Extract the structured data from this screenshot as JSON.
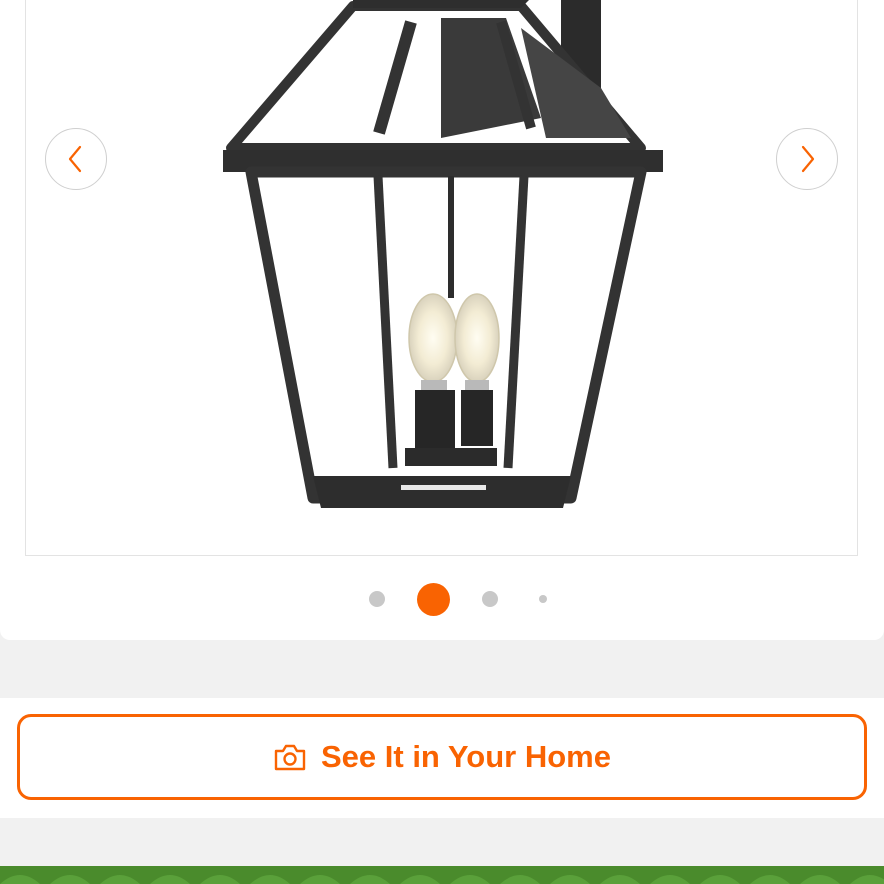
{
  "carousel": {
    "product_image_alt": "Black outdoor wall lantern with clear glass panels and candelabra bulbs",
    "prev_icon": "chevron-left-icon",
    "next_icon": "chevron-right-icon",
    "slide_count": 4,
    "active_slide": 2
  },
  "cta": {
    "label": "See It in Your Home",
    "icon": "camera-icon"
  },
  "colors": {
    "accent": "#f96302",
    "dot_inactive": "#c8c8c8",
    "footer_green": "#4a8b2c",
    "page_bg": "#f1f1f1"
  }
}
